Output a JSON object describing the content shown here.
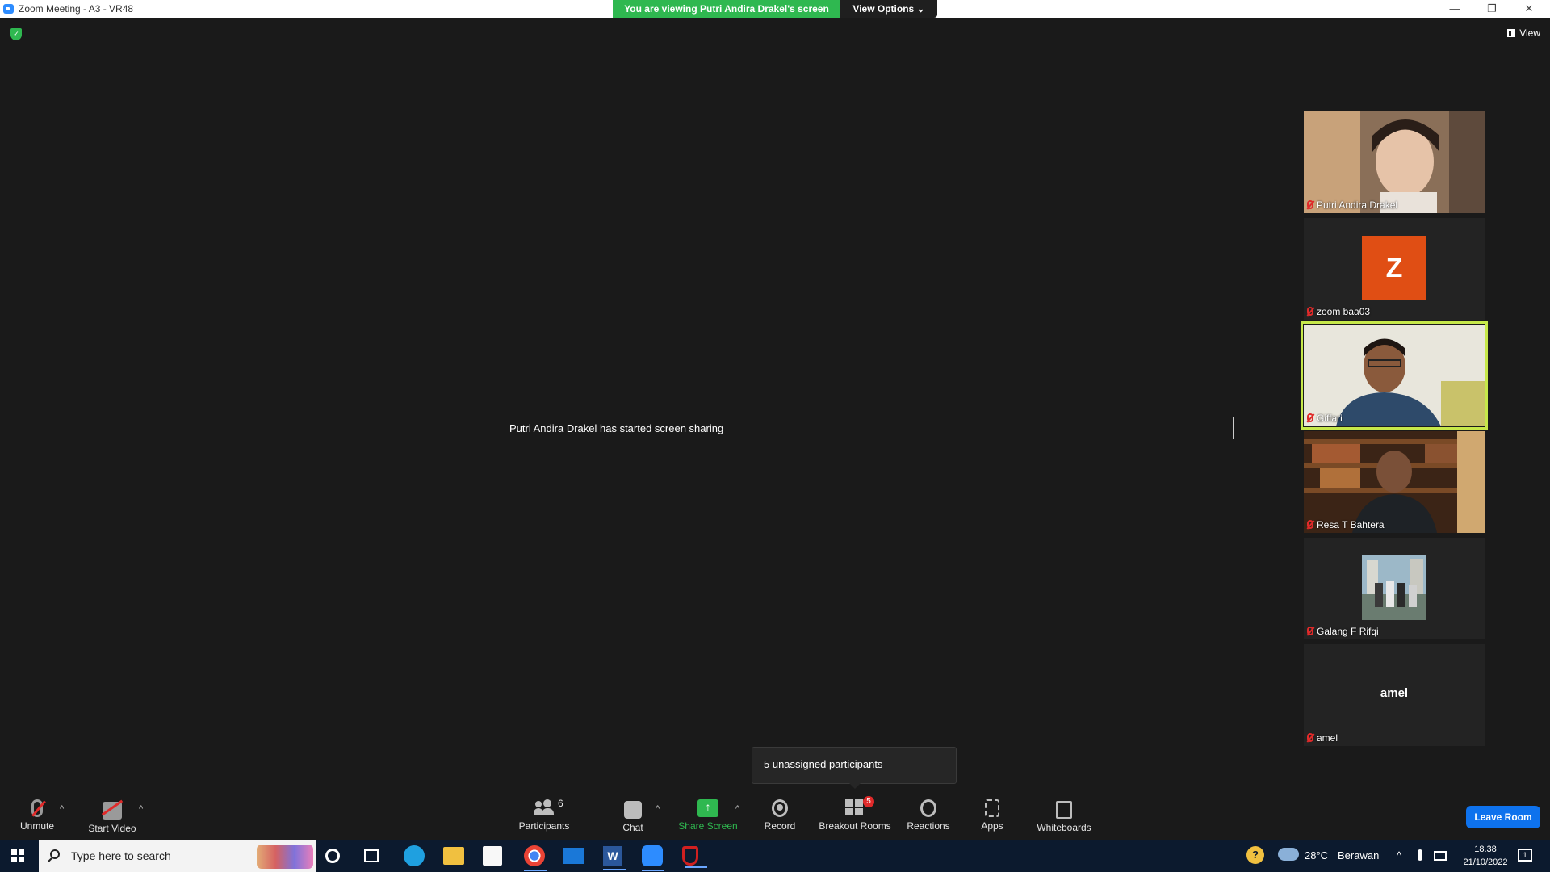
{
  "window": {
    "title": "Zoom Meeting - A3 - VR48",
    "minimize": "—",
    "maximize": "❐",
    "close": "✕"
  },
  "banner": {
    "text": "You are viewing Putri Andira Drakel's screen",
    "view_options": "View Options ⌄"
  },
  "top_right": {
    "view_label": "View"
  },
  "main": {
    "message": "Putri Andira Drakel has started screen sharing"
  },
  "participants": [
    {
      "name": "Putri Andira Drakel",
      "type": "video",
      "muted": true
    },
    {
      "name": "zoom baa03",
      "type": "avatar",
      "initial": "Z",
      "avatar_color": "#e04e14",
      "muted": true
    },
    {
      "name": "Giffari",
      "type": "video",
      "muted": true,
      "active_speaker": true
    },
    {
      "name": "Resa T Bahtera",
      "type": "video",
      "muted": true
    },
    {
      "name": "Galang F Rifqi",
      "type": "picture",
      "muted": true
    },
    {
      "name": "amel",
      "type": "name",
      "display": "amel",
      "muted": true
    }
  ],
  "tooltip": {
    "text": "5 unassigned participants"
  },
  "toolbar": {
    "unmute": "Unmute",
    "start_video": "Start Video",
    "participants": "Participants",
    "participants_count": "6",
    "chat": "Chat",
    "share_screen": "Share Screen",
    "record": "Record",
    "breakout_rooms": "Breakout Rooms",
    "breakout_badge": "5",
    "reactions": "Reactions",
    "apps": "Apps",
    "whiteboards": "Whiteboards",
    "caret": "^",
    "leave_room": "Leave Room"
  },
  "taskbar": {
    "search_placeholder": "Type here to search",
    "weather_temp": "28°C",
    "weather_text": "Berawan",
    "time": "18.38",
    "date": "21/10/2022",
    "notification_count": "1"
  },
  "colors": {
    "banner_green": "#2fb850",
    "active_speaker": "#c6e84a",
    "leave_blue": "#0e72ed",
    "mute_red": "#e02a2a"
  }
}
